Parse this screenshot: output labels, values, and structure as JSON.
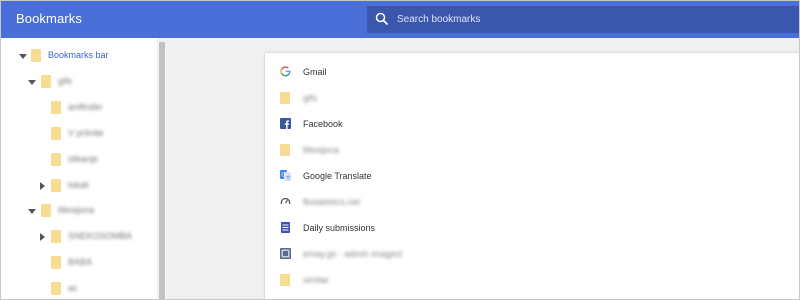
{
  "header": {
    "title": "Bookmarks",
    "search_placeholder": "Search bookmarks"
  },
  "sidebar": {
    "items": [
      {
        "label": "Bookmarks bar",
        "icon": "folder-icon",
        "arrow": "expanded",
        "level": 0,
        "active": true,
        "blurred": false
      },
      {
        "label": "gifs",
        "icon": "folder-icon",
        "arrow": "expanded",
        "level": 1,
        "active": false,
        "blurred": true
      },
      {
        "label": "anifinder",
        "icon": "folder-icon",
        "arrow": "none",
        "level": 2,
        "active": false,
        "blurred": true
      },
      {
        "label": "V pršnite",
        "icon": "folder-icon",
        "arrow": "none",
        "level": 2,
        "active": false,
        "blurred": true
      },
      {
        "label": "slikanje",
        "icon": "folder-icon",
        "arrow": "none",
        "level": 2,
        "active": false,
        "blurred": true
      },
      {
        "label": "lokali",
        "icon": "folder-icon",
        "arrow": "collapsed",
        "level": 2,
        "active": false,
        "blurred": true
      },
      {
        "label": "Mesijona",
        "icon": "folder-icon",
        "arrow": "expanded",
        "level": 1,
        "active": false,
        "blurred": true
      },
      {
        "label": "SNEKOSOMBA",
        "icon": "folder-icon",
        "arrow": "collapsed",
        "level": 2,
        "active": false,
        "blurred": true
      },
      {
        "label": "BABA",
        "icon": "folder-icon",
        "arrow": "none",
        "level": 2,
        "active": false,
        "blurred": true
      },
      {
        "label": "ac",
        "icon": "folder-icon",
        "arrow": "none",
        "level": 2,
        "active": false,
        "blurred": true
      }
    ]
  },
  "bookmarks": [
    {
      "label": "Gmail",
      "icon": "google-g-icon",
      "blurred": false
    },
    {
      "label": "gifs",
      "icon": "folder-icon",
      "blurred": true
    },
    {
      "label": "Facebook",
      "icon": "facebook-icon",
      "blurred": false
    },
    {
      "label": "Mesijona",
      "icon": "folder-icon",
      "blurred": true
    },
    {
      "label": "Google Translate",
      "icon": "google-translate-icon",
      "blurred": false
    },
    {
      "label": "fbstatistics.net",
      "icon": "speedometer-icon",
      "blurred": true
    },
    {
      "label": "Daily submissions",
      "icon": "list-document-icon",
      "blurred": false
    },
    {
      "label": "emay.gs - admin images!",
      "icon": "site-favicon-icon",
      "blurred": true
    },
    {
      "label": "similar",
      "icon": "folder-icon",
      "blurred": true
    }
  ],
  "colors": {
    "header": "#4a6fd8",
    "search_bg": "#3b57ad",
    "folder": "#f6dd92",
    "active_text": "#3e63c8",
    "facebook": "#3b5998",
    "translate": "#4285f4"
  }
}
